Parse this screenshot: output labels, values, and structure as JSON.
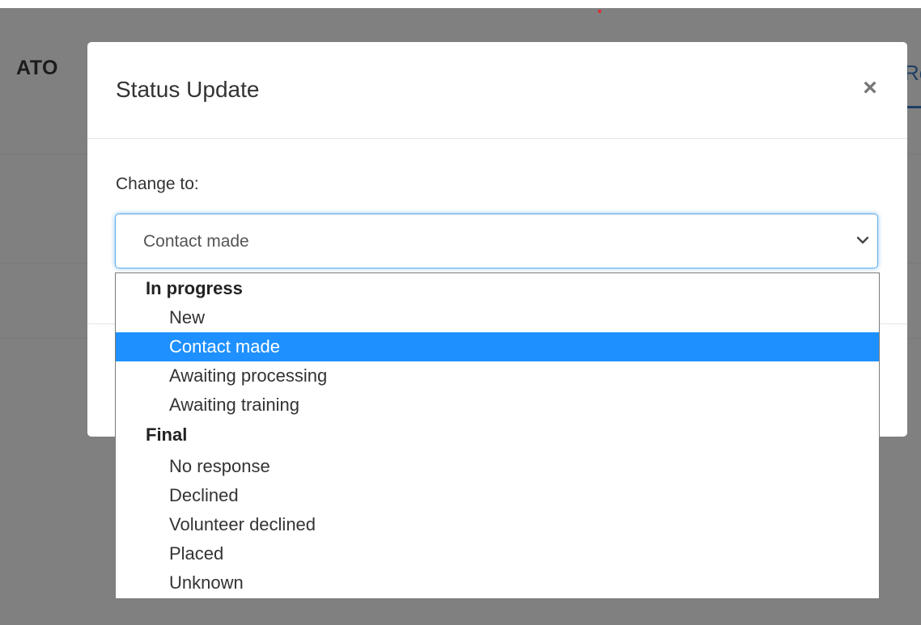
{
  "background": {
    "brand_fragment": "ATO",
    "tab_fragment": "Re",
    "overlay_color": "#808080"
  },
  "modal": {
    "title": "Status Update",
    "close_label": "×",
    "change_label": "Change to:",
    "select": {
      "selected_value": "Contact made",
      "focus_color": "#66afe9"
    }
  },
  "dropdown": {
    "highlight_color": "#1e90ff",
    "groups": [
      {
        "label": "In progress",
        "options": [
          "New",
          "Contact made",
          "Awaiting processing",
          "Awaiting training"
        ]
      },
      {
        "label": "Final",
        "options": [
          "No response",
          "Declined",
          "Volunteer declined",
          "Placed",
          "Unknown"
        ]
      }
    ],
    "selected_option": "Contact made"
  },
  "icons": {
    "close": "close-icon",
    "chevron": "chevron-down-icon"
  }
}
